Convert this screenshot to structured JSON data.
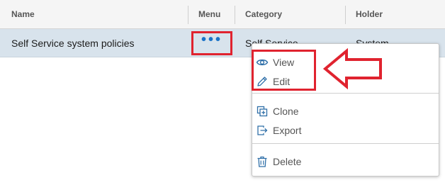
{
  "columns": {
    "name": "Name",
    "menu": "Menu",
    "category": "Category",
    "holder": "Holder"
  },
  "row": {
    "name": "Self Service system policies",
    "category": "Self Service",
    "holder": "System"
  },
  "menu_trigger": {
    "glyph": "•••",
    "icon": "more-horizontal-icon"
  },
  "context_menu": {
    "items": [
      {
        "label": "View",
        "icon": "eye-icon"
      },
      {
        "label": "Edit",
        "icon": "pencil-icon"
      },
      {
        "label": "Clone",
        "icon": "clone-icon"
      },
      {
        "label": "Export",
        "icon": "export-icon"
      },
      {
        "label": "Delete",
        "icon": "trash-icon"
      }
    ]
  },
  "annotation": {
    "color": "#e0232f",
    "arrow_icon": "left-arrow-icon"
  },
  "colors": {
    "selected_row": "#d8e3ec",
    "header_bg": "#f5f5f5",
    "link_blue": "#1a73c8",
    "icon_blue": "#2f6fa8"
  }
}
